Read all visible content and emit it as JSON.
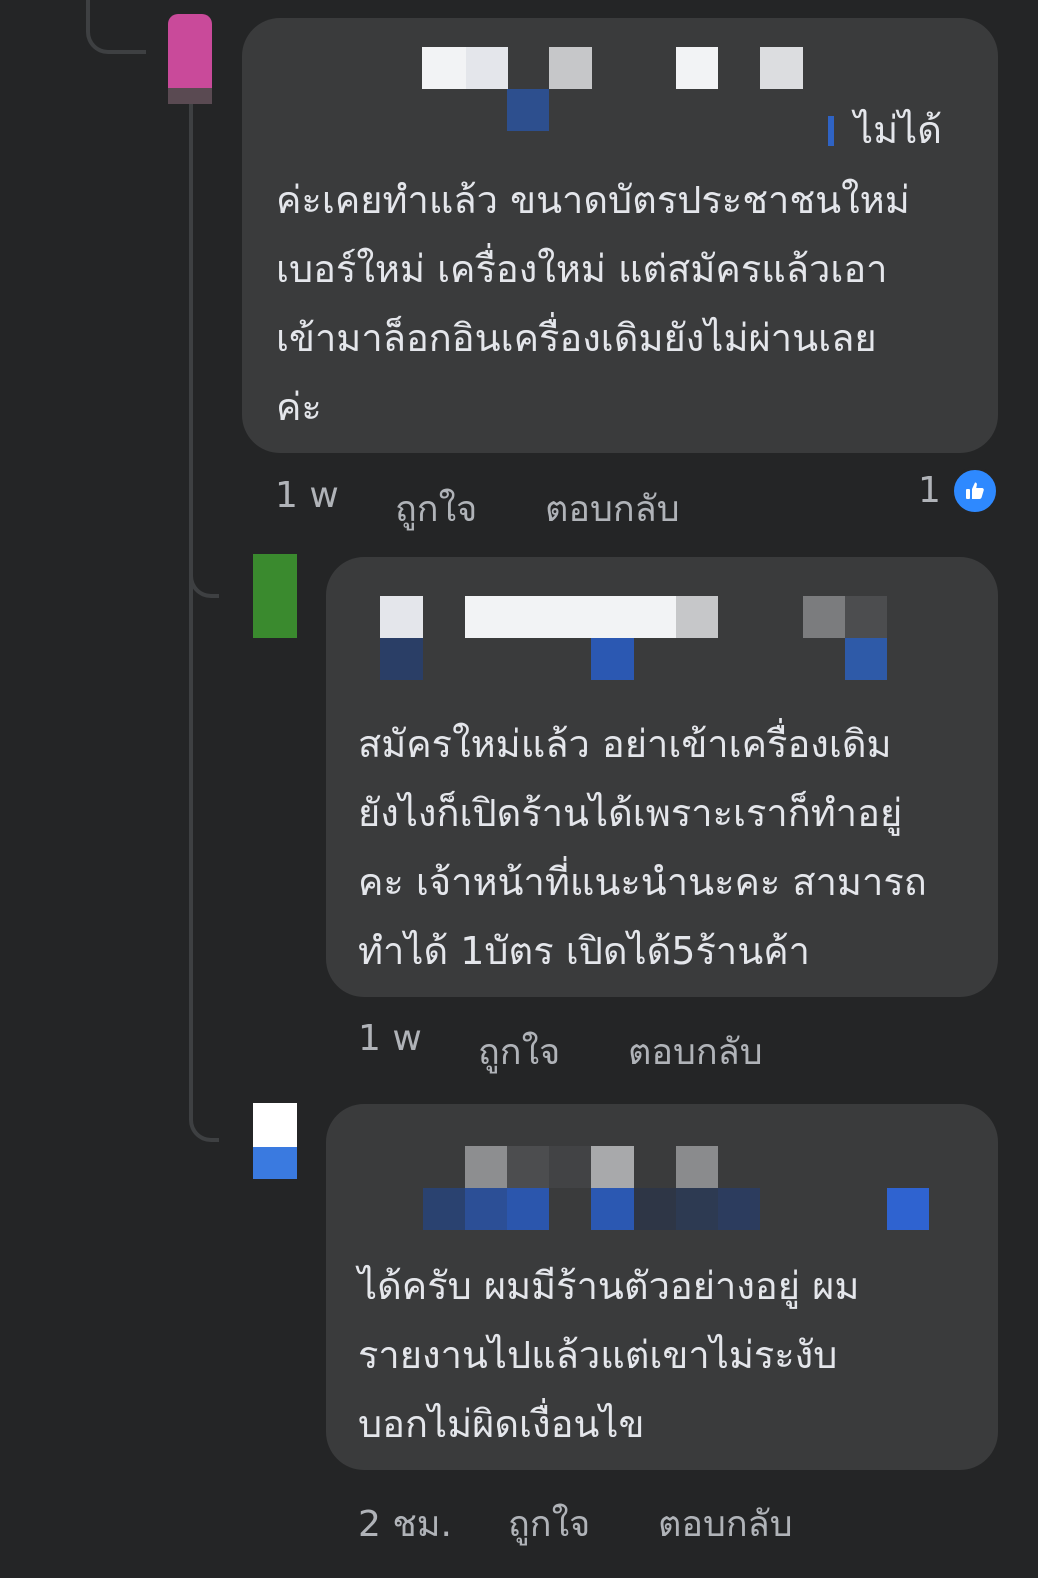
{
  "comments": [
    {
      "author": "",
      "text_lead": "ไม่ได้",
      "text": "ค่ะเคยทำแล้ว ขนาดบัตรประชาชนใหม่\nเบอร์ใหม่ เครื่องใหม่ แต่สมัครแล้วเอา\nเข้ามาล็อกอินเครื่องเดิมยังไม่ผ่านเลย\nค่ะ",
      "time": "1 w",
      "like_label": "ถูกใจ",
      "reply_label": "ตอบกลับ",
      "reaction_count": "1",
      "reaction_icon": "thumbs-up-icon"
    },
    {
      "author": "",
      "text": "สมัครใหม่แล้ว อย่าเข้าเครื่องเดิม\nยังไงก็เปิดร้านได้เพราะเราก็ทำอยู่\nคะ เจ้าหน้าที่แนะนำนะคะ สามารถ\nทำได้ 1บัตร เปิดได้5ร้านค้า",
      "time": "1 w",
      "like_label": "ถูกใจ",
      "reply_label": "ตอบกลับ"
    },
    {
      "author": "",
      "text": "ได้ครับ ผมมีร้านตัวอย่างอยู่ ผม\nรายงานไปแล้วแต่เขาไม่ระงับ\nบอกไม่ผิดเงื่อนไข",
      "time": "2 ชม.",
      "like_label": "ถูกใจ",
      "reply_label": "ตอบกลับ"
    }
  ],
  "colors": {
    "background": "#242526",
    "bubble": "#3a3b3c",
    "text": "#e4e6eb",
    "meta": "#b0b3b8",
    "like_blue": "#2e89ff"
  }
}
